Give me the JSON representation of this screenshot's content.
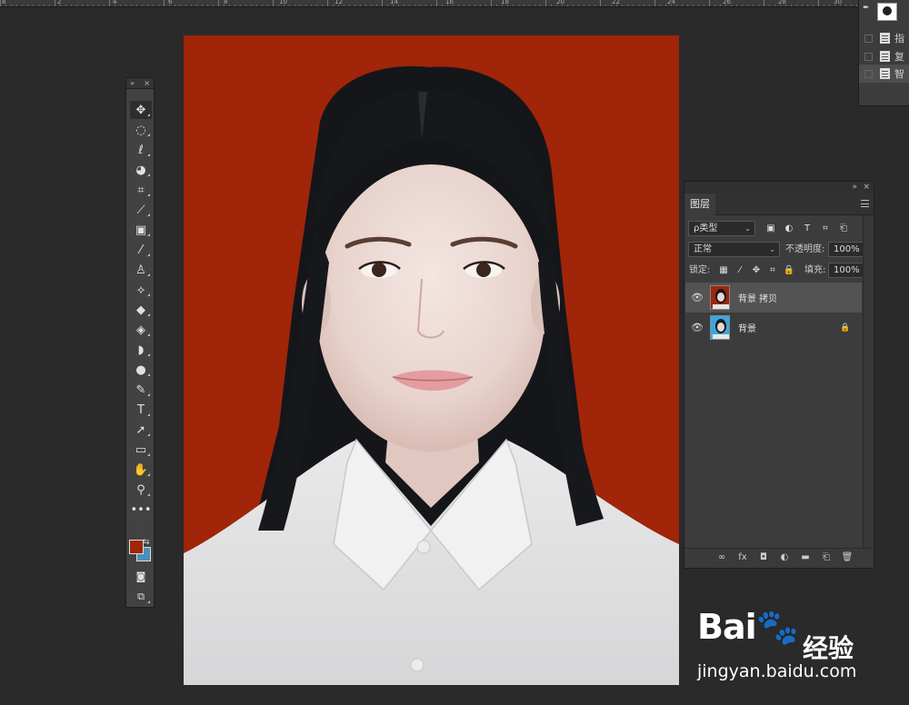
{
  "ruler": {
    "numbers": [
      "8",
      "2",
      "4",
      "6",
      "8",
      "10",
      "12",
      "14",
      "16",
      "18",
      "20",
      "22",
      "24",
      "26",
      "28",
      "30"
    ]
  },
  "tools_panel": {
    "collapse_glyph": "»",
    "close_glyph": "×",
    "items": [
      {
        "name": "move-tool",
        "glyph": "✥"
      },
      {
        "name": "marquee-tool",
        "glyph": "◌"
      },
      {
        "name": "lasso-tool",
        "glyph": "ℓ"
      },
      {
        "name": "quick-select-tool",
        "glyph": "◕"
      },
      {
        "name": "crop-tool",
        "glyph": "⌗"
      },
      {
        "name": "eyedropper-tool",
        "glyph": "⟋"
      },
      {
        "name": "healing-brush-tool",
        "glyph": "▣"
      },
      {
        "name": "brush-tool",
        "glyph": "⁄"
      },
      {
        "name": "clone-stamp-tool",
        "glyph": "♙"
      },
      {
        "name": "history-brush-tool",
        "glyph": "⟡"
      },
      {
        "name": "eraser-tool",
        "glyph": "◆"
      },
      {
        "name": "paint-bucket-tool",
        "glyph": "◈"
      },
      {
        "name": "blur-tool",
        "glyph": "◗"
      },
      {
        "name": "dodge-tool",
        "glyph": "●"
      },
      {
        "name": "pen-tool",
        "glyph": "✎"
      },
      {
        "name": "type-tool",
        "glyph": "T"
      },
      {
        "name": "path-select-tool",
        "glyph": "➚"
      },
      {
        "name": "rectangle-tool",
        "glyph": "▭"
      },
      {
        "name": "hand-tool",
        "glyph": "✋"
      },
      {
        "name": "zoom-tool",
        "glyph": "⚲"
      },
      {
        "name": "more-tools",
        "glyph": "•••"
      }
    ],
    "foreground_color": "#a02509",
    "background_color": "#4a90b8"
  },
  "nav_panel": {
    "rows": [
      {
        "text": "指"
      },
      {
        "text": "复"
      },
      {
        "text": "智"
      }
    ]
  },
  "layers_panel": {
    "tab_label": "图层",
    "filter_label": "ρ类型",
    "filter_icons": [
      "▣",
      "◐",
      "T",
      "⌗",
      "⎗"
    ],
    "blend_mode": "正常",
    "opacity_label": "不透明度:",
    "opacity_value": "100%",
    "lock_label": "锁定:",
    "lock_icons": [
      "▦",
      "⁄",
      "✥",
      "⌗",
      "🔒"
    ],
    "fill_label": "填充:",
    "fill_value": "100%",
    "layers": [
      {
        "name": "背景 拷贝",
        "visible": true,
        "selected": true,
        "locked": false
      },
      {
        "name": "背景",
        "visible": true,
        "selected": false,
        "locked": true
      }
    ],
    "footer_icons": [
      "∞",
      "fx",
      "◘",
      "◐",
      "▬",
      "⎗",
      "🗑"
    ]
  },
  "watermark": {
    "logo_text": "Bai🐾",
    "cn_text": "经验",
    "url": "jingyan.baidu.com"
  },
  "colors": {
    "photo_background": "#a02509",
    "app_background": "#2a2a2a",
    "panel": "#3c3c3c"
  }
}
